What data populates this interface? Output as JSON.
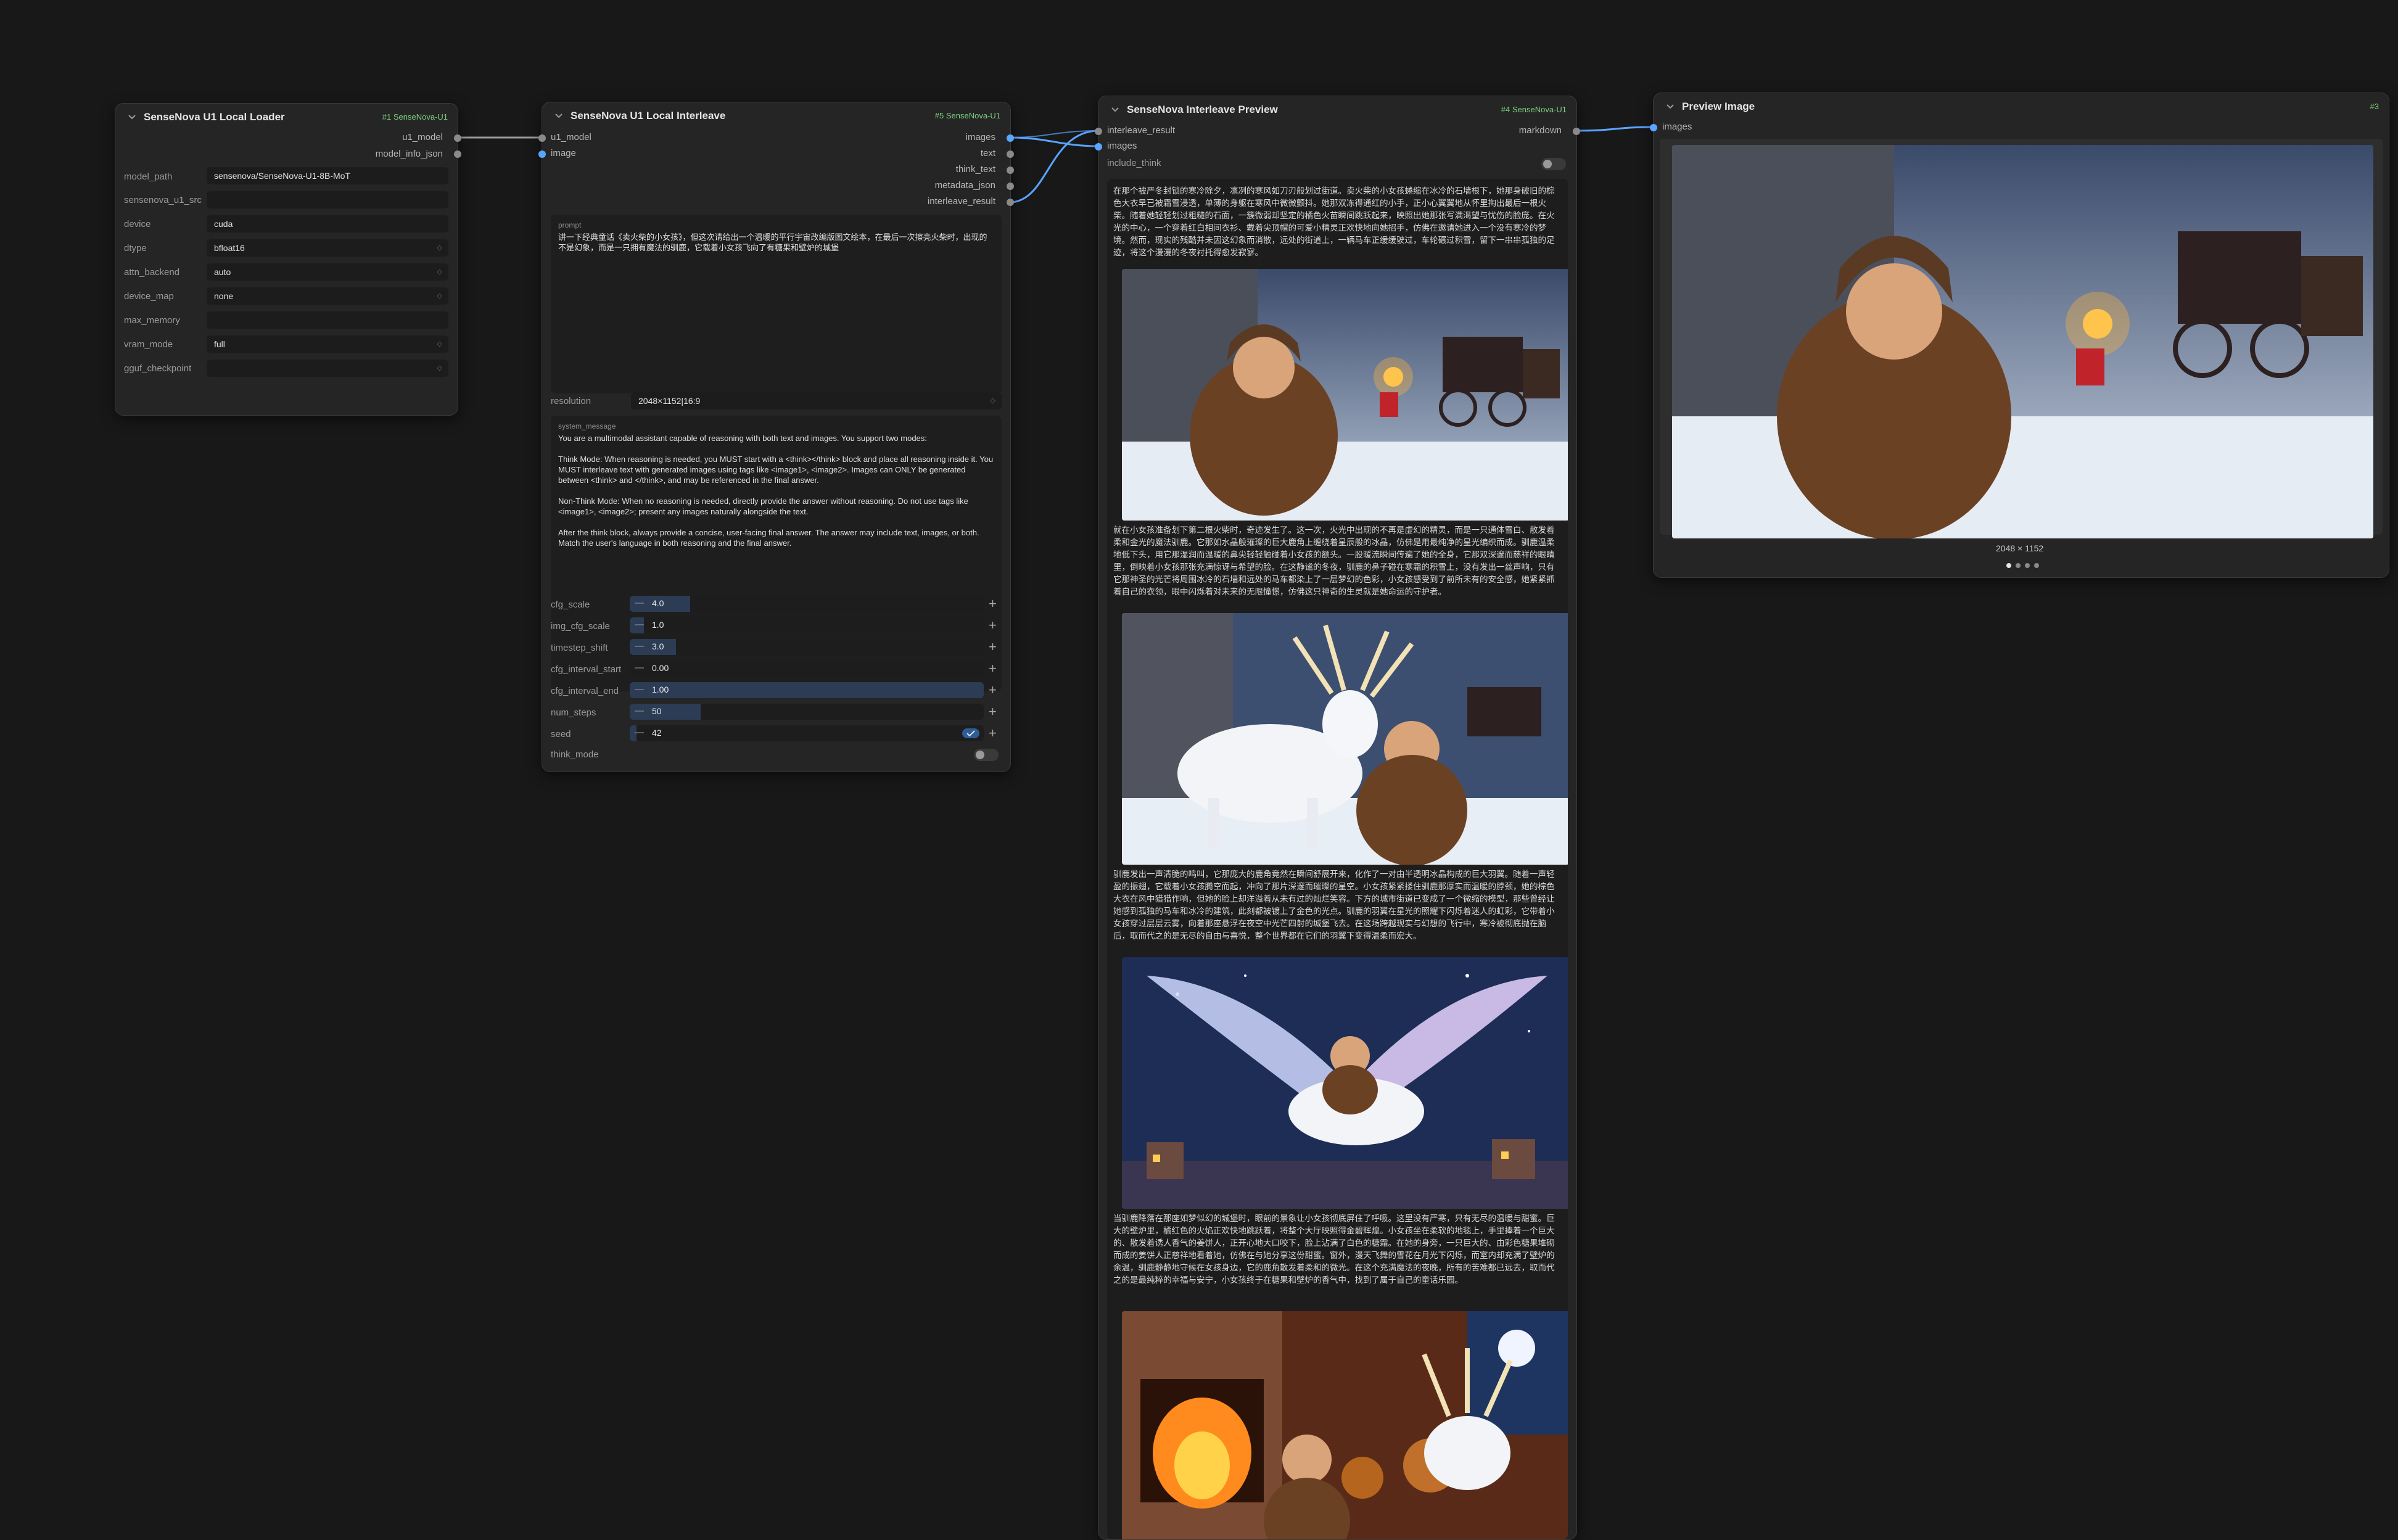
{
  "nodes": {
    "loader": {
      "title": "SenseNova U1 Local Loader",
      "badge": "#1 SenseNova-U1",
      "outputs": [
        "u1_model",
        "model_info_json"
      ],
      "widgets": [
        {
          "label": "model_path",
          "value": "sensenova/SenseNova-U1-8B-MoT",
          "dropdown": false
        },
        {
          "label": "sensenova_u1_src",
          "value": "",
          "dropdown": false
        },
        {
          "label": "device",
          "value": "cuda",
          "dropdown": false
        },
        {
          "label": "dtype",
          "value": "bfloat16",
          "dropdown": true
        },
        {
          "label": "attn_backend",
          "value": "auto",
          "dropdown": true
        },
        {
          "label": "device_map",
          "value": "none",
          "dropdown": true
        },
        {
          "label": "max_memory",
          "value": "",
          "dropdown": false
        },
        {
          "label": "vram_mode",
          "value": "full",
          "dropdown": true
        },
        {
          "label": "gguf_checkpoint",
          "value": "",
          "dropdown": true
        }
      ]
    },
    "interleave": {
      "title": "SenseNova U1 Local Interleave",
      "badge": "#5 SenseNova-U1",
      "inputs": [
        "u1_model",
        "image"
      ],
      "outputs": [
        "images",
        "text",
        "think_text",
        "metadata_json",
        "interleave_result"
      ],
      "prompt_label": "prompt",
      "prompt_text": "讲一下经典童话《卖火柴的小女孩》，但这次请给出一个温暖的平行宇宙改编版图文绘本，在最后一次擦亮火柴时，出现的不是幻象，而是一只拥有魔法的驯鹿，它载着小女孩飞向了有糖果和壁炉的城堡",
      "resolution_label": "resolution",
      "resolution_value": "2048×1152|16:9",
      "system_label": "system_message",
      "system_text": "You are a multimodal assistant capable of reasoning with both text and images. You support two modes:\n\nThink Mode: When reasoning is needed, you MUST start with a <think></think> block and place all reasoning inside it. You MUST interleave text with generated images using tags like <image1>, <image2>. Images can ONLY be generated between <think> and </think>, and may be referenced in the final answer.\n\nNon-Think Mode: When no reasoning is needed, directly provide the answer without reasoning. Do not use tags like <image1>, <image2>; present any images naturally alongside the text.\n\nAfter the think block, always provide a concise, user-facing final answer. The answer may include text, images, or both. Match the user's language in both reasoning and the final answer.",
      "sliders": [
        {
          "label": "cfg_scale",
          "value": "4.0",
          "fill": 0.17
        },
        {
          "label": "img_cfg_scale",
          "value": "1.0",
          "fill": 0.04
        },
        {
          "label": "timestep_shift",
          "value": "3.0",
          "fill": 0.13
        },
        {
          "label": "cfg_interval_start",
          "value": "0.00",
          "fill": 0.0
        },
        {
          "label": "cfg_interval_end",
          "value": "1.00",
          "fill": 1.0
        },
        {
          "label": "num_steps",
          "value": "50",
          "fill": 0.2
        },
        {
          "label": "seed",
          "value": "42",
          "fill": 0.02
        }
      ],
      "think_mode_label": "think_mode"
    },
    "preview": {
      "title": "SenseNova Interleave Preview",
      "badge": "#4 SenseNova-U1",
      "inputs": [
        "interleave_result",
        "images"
      ],
      "outputs": [
        "markdown"
      ],
      "include_think_label": "include_think",
      "paragraphs": [
        "在那个被严冬封锁的寒冷除夕，凛冽的寒风如刀刃般划过街道。卖火柴的小女孩蜷缩在冰冷的石墙根下，她那身破旧的棕色大衣早已被霜雪浸透，单薄的身躯在寒风中微微颤抖。她那双冻得通红的小手，正小心翼翼地从怀里掏出最后一根火柴。随着她轻轻划过粗糙的石面，一簇微弱却坚定的橘色火苗瞬间跳跃起来，映照出她那张写满渴望与忧伤的脸庞。在火光的中心，一个穿着红白相间衣衫、戴着尖顶帽的可爱小精灵正欢快地向她招手，仿佛在邀请她进入一个没有寒冷的梦境。然而，现实的残酷并未因这幻象而消散，远处的街道上，一辆马车正缓缓驶过，车轮碾过积雪，留下一串串孤独的足迹，将这个漫漫的冬夜衬托得愈发寂寥。",
        "就在小女孩准备划下第二根火柴时，奇迹发生了。这一次，火光中出现的不再是虚幻的精灵，而是一只通体雪白、散发着柔和金光的魔法驯鹿。它那如水晶般璀璨的巨大鹿角上缠绕着星辰般的冰晶，仿佛是用最纯净的星光编织而成。驯鹿温柔地低下头，用它那湿润而温暖的鼻尖轻轻触碰着小女孩的额头。一股暖流瞬间传遍了她的全身，它那双深邃而慈祥的眼睛里，倒映着小女孩那张充满惊讶与希望的脸。在这静谧的冬夜，驯鹿的鼻子碰在寒霜的积雪上，没有发出一丝声响，只有它那神圣的光芒将周围冰冷的石墙和远处的马车都染上了一层梦幻的色彩，小女孩感受到了前所未有的安全感，她紧紧抓着自己的衣领，眼中闪烁着对未来的无限憧憬，仿佛这只神奇的生灵就是她命运的守护者。",
        "驯鹿发出一声清脆的鸣叫，它那庞大的鹿角竟然在瞬间舒展开来，化作了一对由半透明冰晶构成的巨大羽翼。随着一声轻盈的振翅，它载着小女孩腾空而起，冲向了那片深邃而璀璨的星空。小女孩紧紧搂住驯鹿那厚实而温暖的脖颈，她的棕色大衣在风中猎猎作响，但她的脸上却洋溢着从未有过的灿烂笑容。下方的城市街道已变成了一个微缩的模型，那些曾经让她感到孤独的马车和冰冷的建筑，此刻都被镀上了金色的光点。驯鹿的羽翼在星光的照耀下闪烁着迷人的虹彩，它带着小女孩穿过层层云雾，向着那座悬浮在夜空中光芒四射的城堡飞去。在这场跨越现实与幻想的飞行中，寒冷被彻底抛在脑后，取而代之的是无尽的自由与喜悦，整个世界都在它们的羽翼下变得温柔而宏大。",
        "当驯鹿降落在那座如梦似幻的城堡时，眼前的景象让小女孩彻底屏住了呼吸。这里没有严寒，只有无尽的温暖与甜蜜。巨大的壁炉里，橘红色的火焰正欢快地跳跃着，将整个大厅映照得金碧辉煌。小女孩坐在柔软的地毯上，手里捧着一个巨大的、散发着诱人香气的姜饼人，正开心地大口咬下，脸上沾满了白色的糖霜。在她的身旁，一只巨大的、由彩色糖果堆砌而成的姜饼人正慈祥地看着她，仿佛在与她分享这份甜蜜。窗外，漫天飞舞的雪花在月光下闪烁，而室内却充满了壁炉的余温，驯鹿静静地守候在女孩身边，它的鹿角散发着柔和的微光。在这个充满魔法的夜晚，所有的苦难都已远去，取而代之的是最纯粹的幸福与安宁，小女孩终于在糖果和壁炉的香气中，找到了属于自己的童话乐园。"
      ]
    },
    "preview_image": {
      "title": "Preview Image",
      "badge": "#3",
      "inputs": [
        "images"
      ],
      "caption": "2048 × 1152",
      "pager_count": 4,
      "pager_active": 0
    }
  },
  "colors": {
    "canvas": "#181818",
    "node_bg": "#252526",
    "image_wire": "#5aa6ff",
    "model_wire": "#9a9a9a",
    "badge_green": "#7bd07b"
  }
}
